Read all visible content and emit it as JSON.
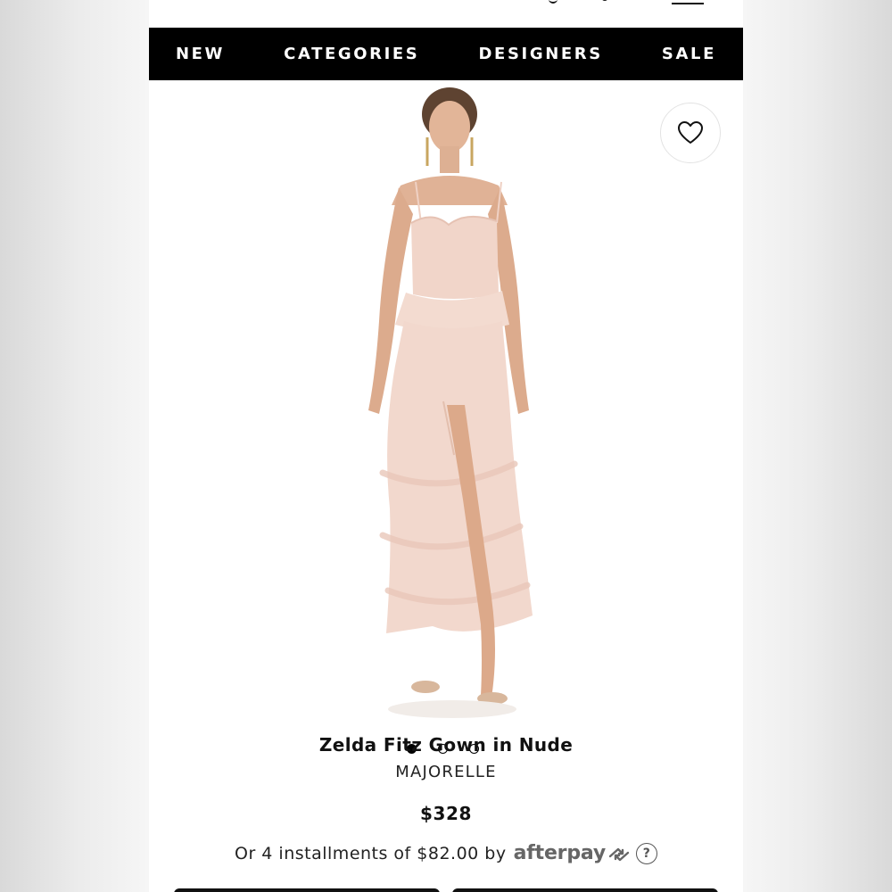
{
  "nav": {
    "items": [
      "NEW",
      "CATEGORIES",
      "DESIGNERS",
      "SALE"
    ]
  },
  "gallery": {
    "image_alt": "Model wearing blush lace tiered gown",
    "slide_count": 3,
    "active_slide": 1
  },
  "product": {
    "name": "Zelda Fitz Gown in Nude",
    "brand": "MAJORELLE",
    "price": "$328"
  },
  "afterpay": {
    "text": "Or 4 installments of $82.00 by",
    "logo": "afterpay",
    "help": "?"
  },
  "icons": {
    "favorite": "heart-icon",
    "afterpay_arrows": "afterpay-arrows-icon",
    "help": "question-icon"
  },
  "colors": {
    "nav_bg": "#000000",
    "dress": "#f1d6cb",
    "afterpay": "#666666"
  }
}
